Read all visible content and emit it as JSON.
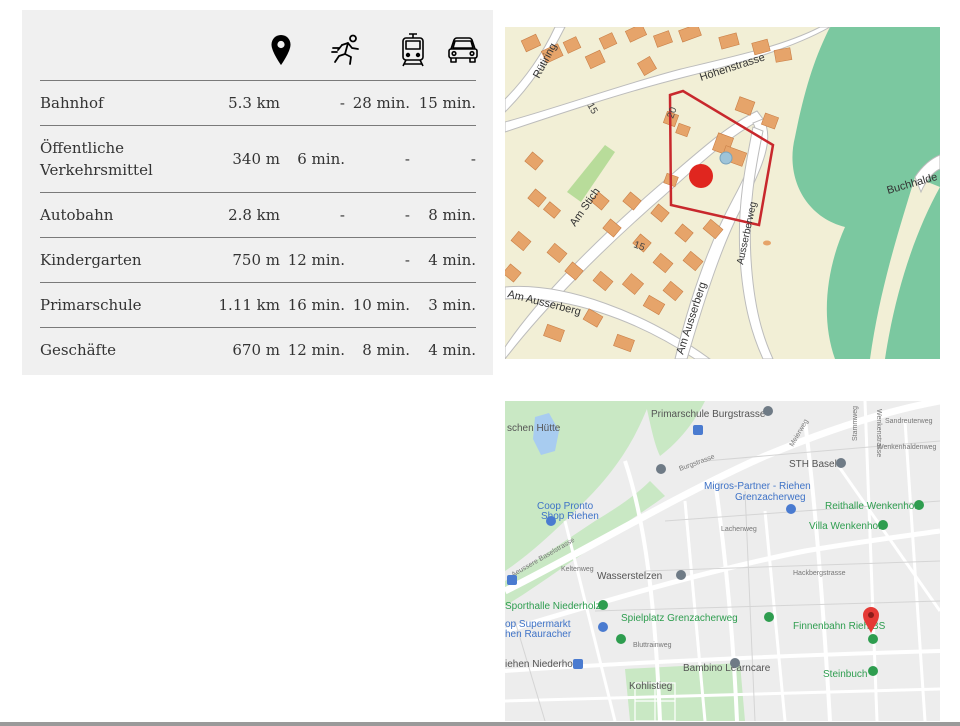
{
  "table": {
    "icons": [
      "location-pin-icon",
      "walking-person-icon",
      "tram-icon",
      "car-icon"
    ],
    "rows": [
      {
        "label": "Bahnhof",
        "distance": "5.3 km",
        "walk": "-",
        "tram": "28 min.",
        "car": "15 min."
      },
      {
        "label": "Öffentliche\nVerkehrsmittel",
        "distance": "340 m",
        "walk": "6 min.",
        "tram": "-",
        "car": "-"
      },
      {
        "label": "Autobahn",
        "distance": "2.8 km",
        "walk": "-",
        "tram": "-",
        "car": "8 min."
      },
      {
        "label": "Kindergarten",
        "distance": "750 m",
        "walk": "12 min.",
        "tram": "-",
        "car": "4 min."
      },
      {
        "label": "Primarschule",
        "distance": "1.11 km",
        "walk": "16 min.",
        "tram": "10 min.",
        "car": "3 min."
      },
      {
        "label": "Geschäfte",
        "distance": "670 m",
        "walk": "12 min.",
        "tram": "8 min.",
        "car": "4 min."
      }
    ]
  },
  "cadastral_map": {
    "streets": {
      "ruetiring": "Rütiring",
      "hoehenstrasse": "Höhenstrasse",
      "am_stich": "Am Stich",
      "ausserberg_1": "Am Ausserberg",
      "ausserberg_2": "Am Ausserberg",
      "ausserberg_weg": "Ausserberweg",
      "buchhalde": "Buchhalde"
    },
    "numbers": {
      "n15a": "15",
      "n20": "20",
      "n15b": "15"
    },
    "colors": {
      "background": "#f2efd6",
      "buildings": "#e6a46a",
      "forest": "#7bc8a0",
      "roads": "#ffffff",
      "parcel": "#c8282d",
      "marker": "#e0261f"
    }
  },
  "street_map": {
    "pois": {
      "primarschule": "Primarschule Burgstrasse",
      "huette": "schen Hütte",
      "burgstrasse": "Burgstrasse",
      "meierweg": "Meierweg",
      "stammweg": "Stammweg",
      "sandreuterweg": "Sandreuterweg",
      "wenkenhaldenweg": "Wenkenhaldenweg",
      "wenkenstrasse": "Wenkenstrasse",
      "stf": "STH Basel",
      "migros_1": "Migros-Partner - Riehen",
      "migros_2": "Grenzacherweg",
      "reithalle": "Reithalle Wenkenhof",
      "villa": "Villa Wenkenhof",
      "coop_1": "Coop Pronto",
      "coop_2": "Shop Riehen",
      "lachenweg": "Lachenweg",
      "baselstrasse": "Aeussere Baselstrasse",
      "keltenweg": "Keltenweg",
      "wasserstelzen": "Wasserstelzen",
      "hackbergstrasse": "Hackbergstrasse",
      "sporthalle": "Sporthalle Niederholz",
      "spielplatz": "Spielplatz Grenzacherweg",
      "finnenbahn": "Finnenbahn Rieh BS",
      "op_supermarkt_1": "op Supermarkt",
      "op_supermarkt_2": "hen Rauracher",
      "bluttrainweg": "Bluttrainweg",
      "niederholz": "iehen Niederholz",
      "bambino": "Bambino Learncare",
      "steinbuch": "Steinbuch",
      "kohlistieg": "Kohlistieg"
    },
    "colors": {
      "background": "#ededed",
      "green": "#c9e8c4",
      "water": "#a8ccf0",
      "pin": "#e53935",
      "poi_green": "#2e9d4f",
      "poi_blue": "#4a7bd0",
      "poi_gray": "#6f7b86"
    }
  }
}
